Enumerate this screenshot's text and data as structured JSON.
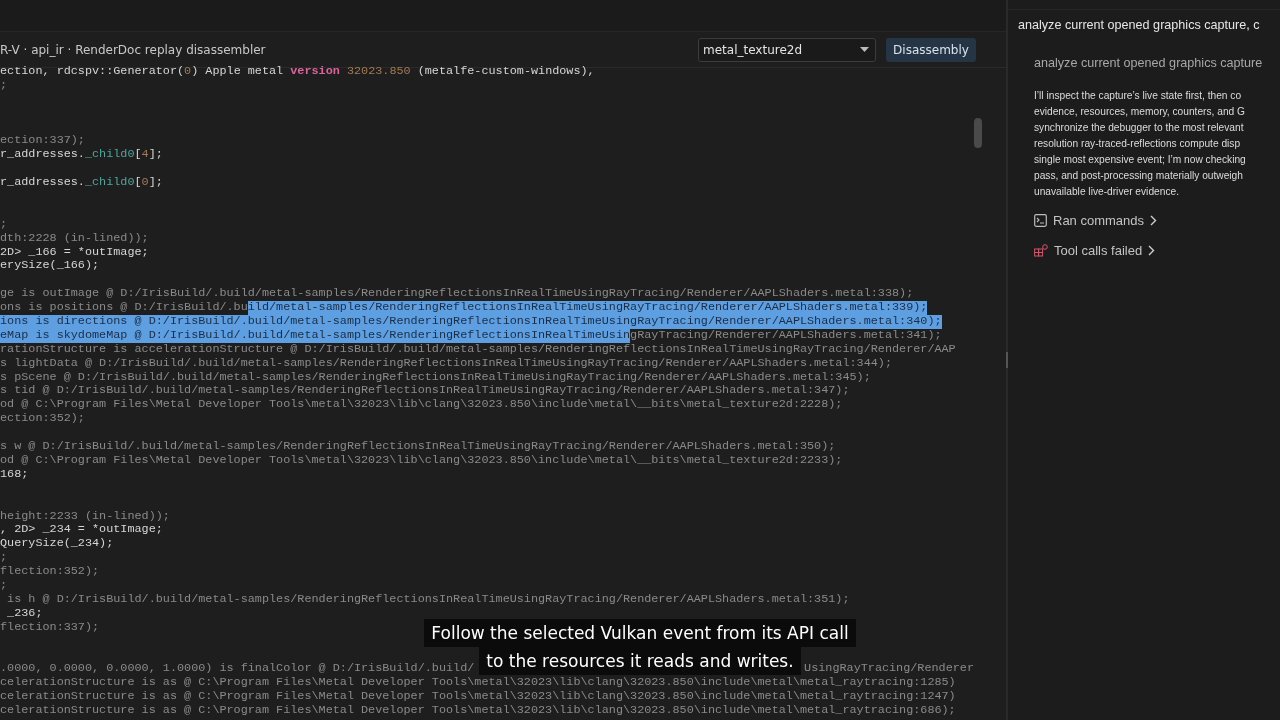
{
  "editor": {
    "title": "R-V · api_ir · RenderDoc replay disassembler",
    "function_select": {
      "value": "metal_texture2d"
    },
    "disassembly_button": "Disassembly",
    "lines": [
      {
        "kind": "code",
        "segments": [
          {
            "text": "ection, rdcspv::Generator(",
            "kind": "plain"
          },
          {
            "text": "0",
            "kind": "number"
          },
          {
            "text": ") Apple metal",
            "kind": "plain"
          },
          {
            "text": "version",
            "kind": "keyword"
          },
          {
            "text": "32023.850",
            "kind": "number"
          },
          {
            "text": "(metalfe-custom-windows),",
            "kind": "plain"
          }
        ]
      },
      {
        "kind": "code",
        "segments": [
          {
            "text": ";",
            "kind": "dim"
          }
        ]
      },
      {
        "kind": "blank"
      },
      {
        "kind": "blank"
      },
      {
        "kind": "blank"
      },
      {
        "kind": "code",
        "segments": [
          {
            "text": "ection:337);",
            "kind": "dim"
          }
        ]
      },
      {
        "kind": "code",
        "segments": [
          {
            "text": "r_addresses.",
            "kind": "plain"
          },
          {
            "text": "_child0",
            "kind": "member"
          },
          {
            "text": "[",
            "kind": "plain"
          },
          {
            "text": "4",
            "kind": "number"
          },
          {
            "text": "];",
            "kind": "plain"
          }
        ]
      },
      {
        "kind": "blank"
      },
      {
        "kind": "code",
        "segments": [
          {
            "text": "r_addresses.",
            "kind": "plain"
          },
          {
            "text": "_child0",
            "kind": "member"
          },
          {
            "text": "[",
            "kind": "plain"
          },
          {
            "text": "0",
            "kind": "number"
          },
          {
            "text": "];",
            "kind": "plain"
          }
        ]
      },
      {
        "kind": "blank"
      },
      {
        "kind": "blank"
      },
      {
        "kind": "code",
        "segments": [
          {
            "text": ";",
            "kind": "dim"
          }
        ]
      },
      {
        "kind": "code",
        "segments": [
          {
            "text": "dth:2228 (in-lined));",
            "kind": "dim"
          }
        ]
      },
      {
        "kind": "code",
        "segments": [
          {
            "text": "2D> _166 = *outImage;",
            "kind": "plain"
          }
        ]
      },
      {
        "kind": "code",
        "segments": [
          {
            "text": "erySize(_166);",
            "kind": "plain"
          }
        ]
      },
      {
        "kind": "blank"
      },
      {
        "kind": "code",
        "segments": [
          {
            "text": "ge is outImage @ D:/IrisBuild/.build/metal-samples/RenderingReflectionsInRealTimeUsingRayTracing/Renderer/AAPLShaders.metal:338);",
            "kind": "dim"
          }
        ]
      },
      {
        "kind": "code",
        "segments": [
          {
            "text": "ons is positions @ D:/IrisBuild/.bu",
            "kind": "dim"
          },
          {
            "text": "ild/metal-samples/RenderingReflectionsInRealTimeUsingRayTracing/Renderer/AAPLShaders.metal:339);",
            "kind": "selected"
          }
        ]
      },
      {
        "kind": "code",
        "segments": [
          {
            "text": "ions is directions @ D:/IrisBuild/.build/metal-samples/RenderingReflectionsInRealTimeUsingRayTracing/Renderer/AAPLShaders.metal:340);",
            "kind": "selected"
          }
        ]
      },
      {
        "kind": "code",
        "segments": [
          {
            "text": "eMap is skydomeMap @ D:/IrisBuild/.build/metal-samples/RenderingReflectionsInRealTimeUsin",
            "kind": "selected"
          },
          {
            "text": "gRayTracing/Renderer/AAPLShaders.metal:341);",
            "kind": "dim"
          }
        ]
      },
      {
        "kind": "code",
        "segments": [
          {
            "text": "rationStructure is accelerationStructure @ D:/IrisBuild/.build/metal-samples/RenderingReflectionsInRealTimeUsingRayTracing/Renderer/AAP",
            "kind": "dim"
          }
        ]
      },
      {
        "kind": "code",
        "segments": [
          {
            "text": "s lightData @ D:/IrisBuild/.build/metal-samples/RenderingReflectionsInRealTimeUsingRayTracing/Renderer/AAPLShaders.metal:344);",
            "kind": "dim"
          }
        ]
      },
      {
        "kind": "code",
        "segments": [
          {
            "text": "s pScene @ D:/IrisBuild/.build/metal-samples/RenderingReflectionsInRealTimeUsingRayTracing/Renderer/AAPLShaders.metal:345);",
            "kind": "dim"
          }
        ]
      },
      {
        "kind": "code",
        "segments": [
          {
            "text": "s tid @ D:/IrisBuild/.build/metal-samples/RenderingReflectionsInRealTimeUsingRayTracing/Renderer/AAPLShaders.metal:347);",
            "kind": "dim"
          }
        ]
      },
      {
        "kind": "code",
        "segments": [
          {
            "text": "od @ C:\\Program Files\\Metal Developer Tools\\metal\\32023\\lib\\clang\\32023.850\\include\\metal\\__bits\\metal_texture2d:2228);",
            "kind": "dim"
          }
        ]
      },
      {
        "kind": "code",
        "segments": [
          {
            "text": "ection:352);",
            "kind": "dim"
          }
        ]
      },
      {
        "kind": "blank"
      },
      {
        "kind": "code",
        "segments": [
          {
            "text": "s w @ D:/IrisBuild/.build/metal-samples/RenderingReflectionsInRealTimeUsingRayTracing/Renderer/AAPLShaders.metal:350);",
            "kind": "dim"
          }
        ]
      },
      {
        "kind": "code",
        "segments": [
          {
            "text": "od @ C:\\Program Files\\Metal Developer Tools\\metal\\32023\\lib\\clang\\32023.850\\include\\metal\\__bits\\metal_texture2d:2233);",
            "kind": "dim"
          }
        ]
      },
      {
        "kind": "code",
        "segments": [
          {
            "text": "168;",
            "kind": "plain"
          }
        ]
      },
      {
        "kind": "blank"
      },
      {
        "kind": "blank"
      },
      {
        "kind": "code",
        "segments": [
          {
            "text": "height:2233 (in-lined));",
            "kind": "dim"
          }
        ]
      },
      {
        "kind": "code",
        "segments": [
          {
            "text": ", 2D> _234 = *outImage;",
            "kind": "plain"
          }
        ]
      },
      {
        "kind": "code",
        "segments": [
          {
            "text": "QuerySize(_234);",
            "kind": "plain"
          }
        ]
      },
      {
        "kind": "code",
        "segments": [
          {
            "text": ";",
            "kind": "dim"
          }
        ]
      },
      {
        "kind": "code",
        "segments": [
          {
            "text": "flection:352);",
            "kind": "dim"
          }
        ]
      },
      {
        "kind": "code",
        "segments": [
          {
            "text": ";",
            "kind": "dim"
          }
        ]
      },
      {
        "kind": "code",
        "segments": [
          {
            "text": "is h @ D:/IrisBuild/.build/metal-samples/RenderingReflectionsInRealTimeUsingRayTracing/Renderer/AAPLShaders.metal:351);",
            "kind": "indented"
          }
        ]
      },
      {
        "kind": "code",
        "segments": [
          {
            "text": "_236;",
            "kind": "indented_plain"
          }
        ]
      },
      {
        "kind": "code",
        "segments": [
          {
            "text": "flection:337);",
            "kind": "dim"
          }
        ]
      },
      {
        "kind": "blank"
      },
      {
        "kind": "blank"
      },
      {
        "kind": "code",
        "segments": [
          {
            "text": ".0000, 0.0000, 0.0000, 1.0000) is finalColor @ D:/IrisBuild/.build/",
            "kind": "dim"
          },
          {
            "text": "UsingRayTracing/Renderer",
            "kind": "right"
          }
        ]
      },
      {
        "kind": "code",
        "segments": [
          {
            "text": "celerationStructure is as @ C:\\Program Files\\Metal Developer Tools\\metal\\32023\\lib\\clang\\32023.850\\include\\metal\\metal_raytracing:1285)",
            "kind": "dim"
          }
        ]
      },
      {
        "kind": "code",
        "segments": [
          {
            "text": "celerationStructure is as @ C:\\Program Files\\Metal Developer Tools\\metal\\32023\\lib\\clang\\32023.850\\include\\metal\\metal_raytracing:1247)",
            "kind": "dim"
          }
        ]
      },
      {
        "kind": "code",
        "segments": [
          {
            "text": "celerationStructure is as @ C:\\Program Files\\Metal Developer Tools\\metal\\32023\\lib\\clang\\32023.850\\include\\metal\\metal_raytracing:686);",
            "kind": "dim"
          }
        ]
      }
    ]
  },
  "caption_lines": [
    "Follow the selected Vulkan event from its API call",
    "to the resources it reads and writes."
  ],
  "chat": {
    "heading": "analyze current opened graphics capture, c",
    "user_message": "analyze current opened graphics capture",
    "reply_lines": [
      "I’ll inspect the capture’s live state first, then co",
      "evidence, resources, memory, counters, and G",
      "synchronize the debugger to the most relevant",
      "resolution ray-traced-reflections compute disp",
      "single most expensive event; I’m now checking",
      "pass, and post-processing materially outweigh",
      "unavailable live-driver evidence."
    ],
    "actions": [
      {
        "kind": "commands",
        "label": "Ran commands"
      },
      {
        "kind": "failed",
        "label": "Tool calls failed"
      }
    ]
  }
}
